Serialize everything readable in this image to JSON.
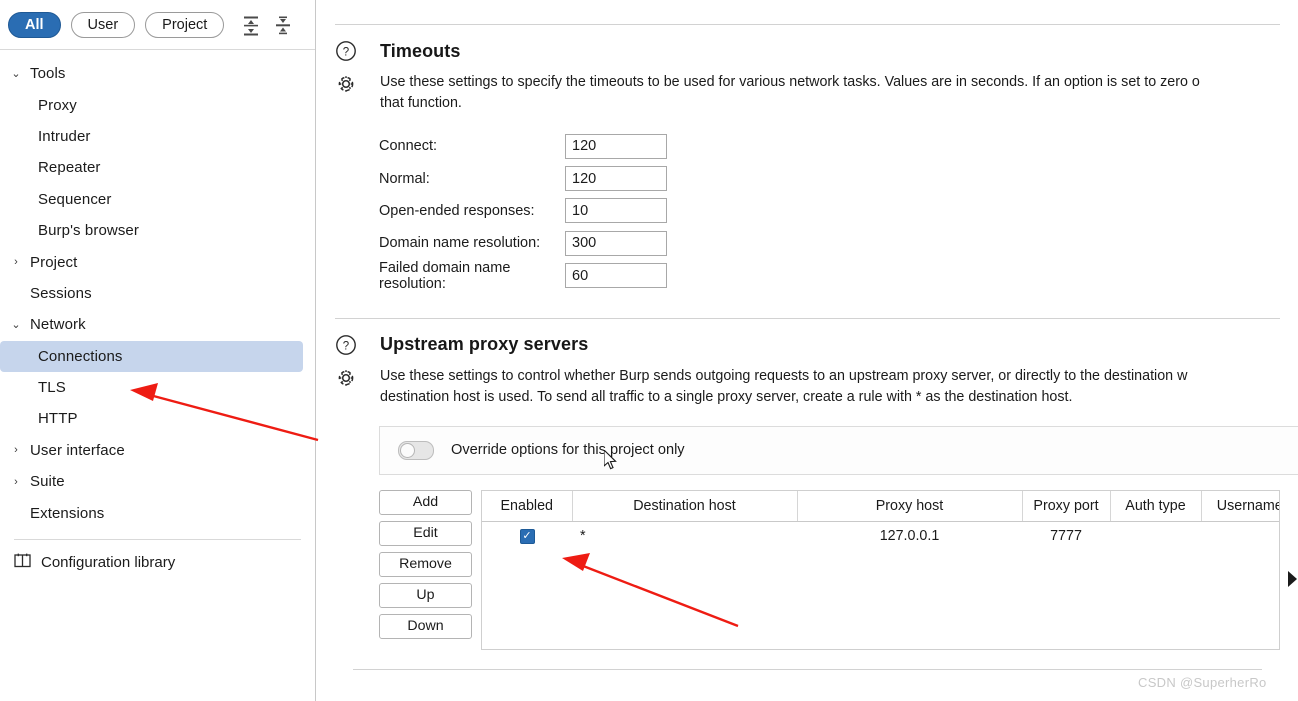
{
  "sidebar": {
    "filters": [
      {
        "label": "All",
        "active": true
      },
      {
        "label": "User",
        "active": false
      },
      {
        "label": "Project",
        "active": false
      }
    ],
    "toolbar_icons": [
      "expand-all-icon",
      "collapse-all-icon"
    ],
    "tree": [
      {
        "label": "Tools",
        "level": 0,
        "arrow": "v",
        "selected": false
      },
      {
        "label": "Proxy",
        "level": 1,
        "arrow": "",
        "selected": false
      },
      {
        "label": "Intruder",
        "level": 1,
        "arrow": "",
        "selected": false
      },
      {
        "label": "Repeater",
        "level": 1,
        "arrow": "",
        "selected": false
      },
      {
        "label": "Sequencer",
        "level": 1,
        "arrow": "",
        "selected": false
      },
      {
        "label": "Burp's browser",
        "level": 1,
        "arrow": "",
        "selected": false
      },
      {
        "label": "Project",
        "level": 0,
        "arrow": ">",
        "selected": false
      },
      {
        "label": "Sessions",
        "level": 0,
        "arrow": "",
        "selected": false
      },
      {
        "label": "Network",
        "level": 0,
        "arrow": "v",
        "selected": false
      },
      {
        "label": "Connections",
        "level": 1,
        "arrow": "",
        "selected": true
      },
      {
        "label": "TLS",
        "level": 1,
        "arrow": "",
        "selected": false
      },
      {
        "label": "HTTP",
        "level": 1,
        "arrow": "",
        "selected": false
      },
      {
        "label": "User interface",
        "level": 0,
        "arrow": ">",
        "selected": false
      },
      {
        "label": "Suite",
        "level": 0,
        "arrow": ">",
        "selected": false
      },
      {
        "label": "Extensions",
        "level": 0,
        "arrow": "",
        "selected": false
      }
    ],
    "config_library": "Configuration library"
  },
  "timeouts": {
    "title": "Timeouts",
    "description_line1": "Use these settings to specify the timeouts to be used for various network tasks. Values are in seconds. If an option is set to zero o",
    "description_line2": "that function.",
    "fields": [
      {
        "label": "Connect:",
        "value": "120"
      },
      {
        "label": "Normal:",
        "value": "120"
      },
      {
        "label": "Open-ended responses:",
        "value": "10"
      },
      {
        "label": "Domain name resolution:",
        "value": "300"
      },
      {
        "label": "Failed domain name resolution:",
        "value": "60"
      }
    ]
  },
  "upstream": {
    "title": "Upstream proxy servers",
    "description_line1": "Use these settings to  control whether Burp sends outgoing requests to an upstream proxy server, or directly to the destination w",
    "description_line2": "destination host is used. To send all traffic to a single proxy server, create a rule with * as the destination host.",
    "override_toggle_label": "Override options for this project only",
    "override_toggle_on": false,
    "buttons": [
      "Add",
      "Edit",
      "Remove",
      "Up",
      "Down"
    ],
    "table": {
      "columns": [
        "Enabled",
        "Destination host",
        "Proxy host",
        "Proxy port",
        "Auth type",
        "Username"
      ],
      "rows": [
        {
          "enabled": true,
          "destination_host": "*",
          "proxy_host": "127.0.0.1",
          "proxy_port": "7777",
          "auth_type": "",
          "username": ""
        }
      ]
    }
  },
  "watermark": "CSDN @SuperherRo",
  "colors": {
    "accent": "#2a6db3",
    "selection": "#c6d5ec",
    "annotation": "#ee1c13"
  }
}
